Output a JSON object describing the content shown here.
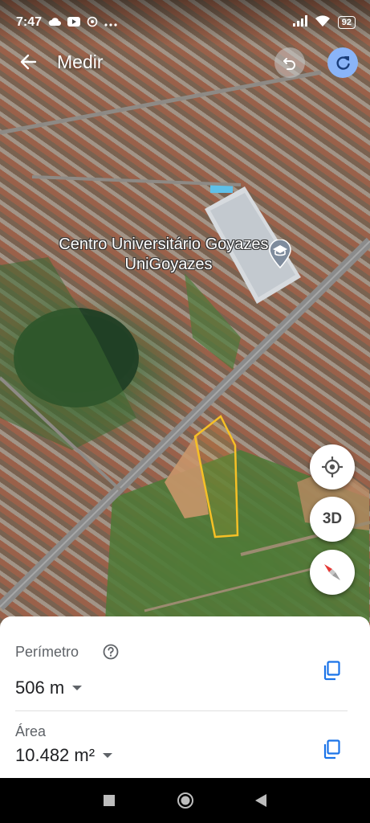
{
  "status_bar": {
    "time": "7:47",
    "notification_icons": [
      "cloud-icon",
      "youtube-icon",
      "sync-icon",
      "more-icon"
    ],
    "battery": "92"
  },
  "app_bar": {
    "title": "Medir"
  },
  "map": {
    "poi_name": "Centro Universitário Goyazes - UniGoyazes",
    "polygon_color": "#F6C026",
    "fab_3d_label": "3D"
  },
  "measurement": {
    "perimeter_label": "Perímetro",
    "perimeter_value": "506 m",
    "area_label": "Área",
    "area_value": "10.482 m²"
  },
  "colors": {
    "accent": "#1A73E8",
    "redo_bg": "#8AB4F8"
  }
}
